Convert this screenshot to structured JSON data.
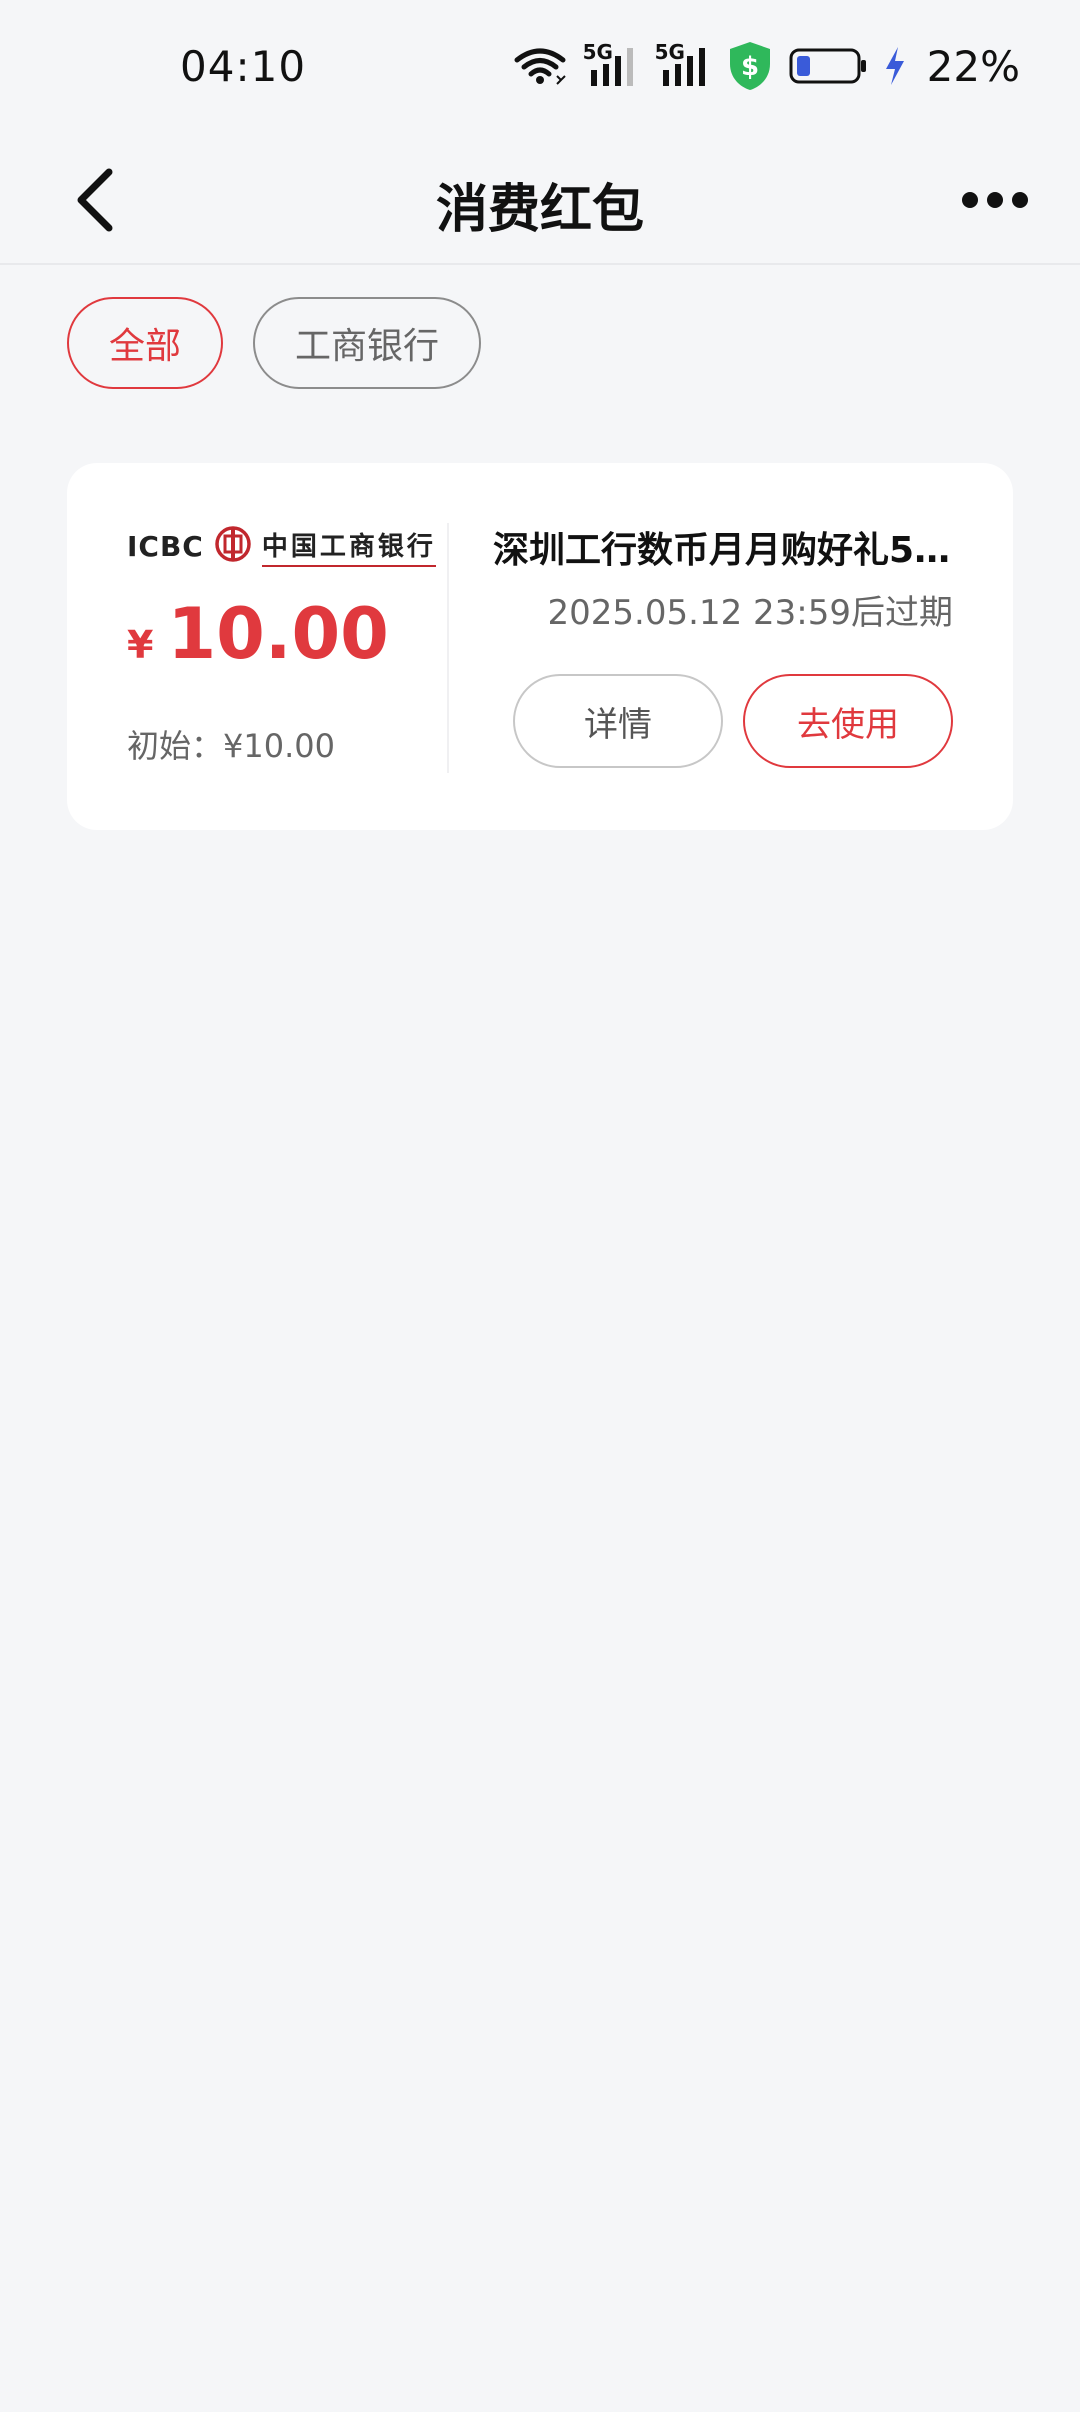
{
  "status_bar": {
    "time": "04:10",
    "battery_percent": "22%",
    "icons": [
      "wifi-icon",
      "5g-signal-icon",
      "5g-signal-icon",
      "security-shield-icon",
      "battery-icon",
      "charging-icon"
    ],
    "signal_label_1": "5G",
    "signal_label_2": "5G",
    "shield_color": "#2fb85b",
    "charging_color": "#3a5bd9"
  },
  "nav": {
    "title": "消费红包",
    "back_icon": "chevron-left-icon",
    "more_icon": "more-dots-icon"
  },
  "filters": {
    "items": [
      {
        "label": "全部",
        "selected": true
      },
      {
        "label": "工商银行",
        "selected": false
      }
    ]
  },
  "cards": [
    {
      "bank_logo_latin": "ICBC",
      "bank_logo_cn": "中国工商银行",
      "currency_symbol": "¥",
      "amount": "10.00",
      "initial": "初始：¥10.00",
      "title": "深圳工行数币月月购好礼5...",
      "expiry": "2025.05.12 23:59后过期",
      "detail_label": "详情",
      "use_label": "去使用"
    }
  ],
  "colors": {
    "accent": "#e0393e",
    "background": "#f5f6f8",
    "card": "#ffffff"
  }
}
